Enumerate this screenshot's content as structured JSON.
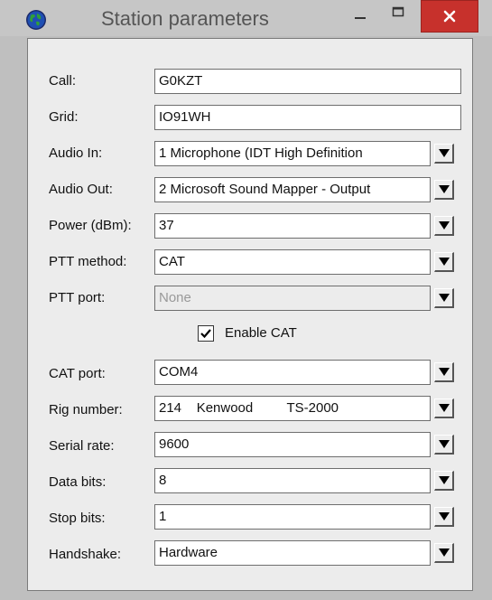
{
  "window": {
    "title": "Station parameters",
    "icon": "globe-icon",
    "buttons": {
      "minimize": "minimize-icon",
      "maximize": "maximize-icon",
      "close": "close-icon"
    }
  },
  "fields": [
    {
      "label": "Call:",
      "value": "G0KZT",
      "kind": "text"
    },
    {
      "label": "Grid:",
      "value": "IO91WH",
      "kind": "text"
    },
    {
      "label": "Audio In:",
      "value": "1 Microphone (IDT High Definition",
      "kind": "combo"
    },
    {
      "label": "Audio Out:",
      "value": "2 Microsoft Sound Mapper - Output",
      "kind": "combo"
    },
    {
      "label": "Power (dBm):",
      "value": "37",
      "kind": "combo"
    },
    {
      "label": "PTT method:",
      "value": "CAT",
      "kind": "combo"
    },
    {
      "label": "PTT port:",
      "value": "None",
      "kind": "combo",
      "disabled": true
    }
  ],
  "enable_cat": {
    "label": "Enable CAT",
    "checked": true
  },
  "cat_fields": [
    {
      "label": "CAT port:",
      "value": "COM4"
    },
    {
      "label": "Rig number:",
      "value": "214    Kenwood         TS-2000"
    },
    {
      "label": "Serial rate:",
      "value": "9600"
    },
    {
      "label": "Data bits:",
      "value": "8"
    },
    {
      "label": "Stop bits:",
      "value": "1"
    },
    {
      "label": "Handshake:",
      "value": "Hardware"
    }
  ],
  "colors": {
    "close_button": "#c7312c",
    "dialog_background": "#ececec",
    "window_frame": "#bfbfbf"
  }
}
